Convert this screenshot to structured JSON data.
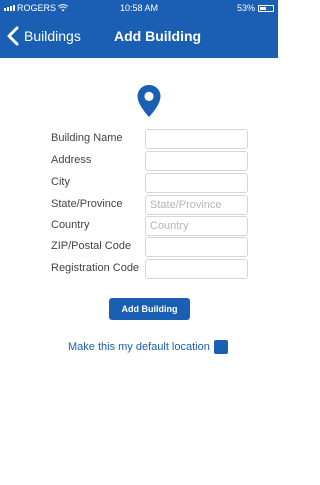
{
  "status_bar": {
    "carrier": "ROGERS",
    "time": "10:58 AM",
    "battery": "53%",
    "battery_level": 0.53
  },
  "nav": {
    "back_label": "Buildings",
    "title": "Add Building"
  },
  "form": {
    "fields": [
      {
        "label": "Building Name",
        "value": "",
        "placeholder": ""
      },
      {
        "label": "Address",
        "value": "",
        "placeholder": ""
      },
      {
        "label": "City",
        "value": "",
        "placeholder": ""
      },
      {
        "label": "State/Province",
        "value": "",
        "placeholder": "State/Province"
      },
      {
        "label": "Country",
        "value": "",
        "placeholder": "Country"
      },
      {
        "label": "ZIP/Postal Code",
        "value": "",
        "placeholder": ""
      },
      {
        "label": "Registration Code",
        "value": "",
        "placeholder": ""
      }
    ],
    "submit_label": "Add Building",
    "default_location_label": "Make this my default location"
  },
  "colors": {
    "brand": "#1a5fb4"
  },
  "icons": {
    "location": "location-pin-icon",
    "back": "chevron-left-icon",
    "wifi": "wifi-icon",
    "battery": "battery-icon"
  }
}
